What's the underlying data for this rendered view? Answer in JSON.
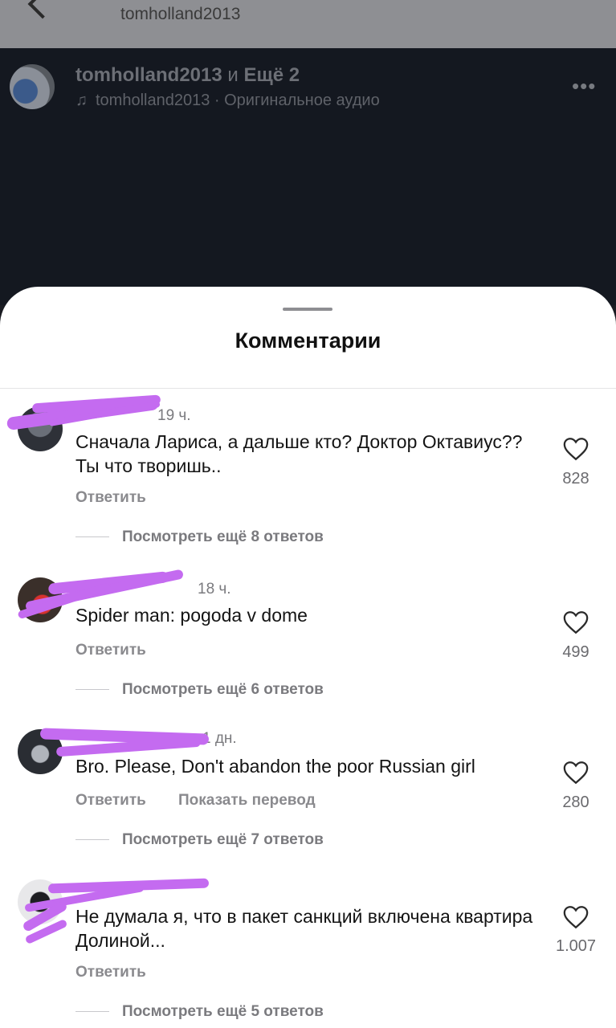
{
  "header": {
    "username": "tomholland2013"
  },
  "post": {
    "author": "tomholland2013",
    "conj": "и",
    "others": "Ещё 2",
    "audio_text": "tomholland2013 · Оригинальное аудио"
  },
  "sheet": {
    "title": "Комментарии"
  },
  "comments": [
    {
      "meta_suffix": "19 ч.",
      "text": "Сначала Лариса, а дальше кто? Доктор Октавиус?? Ты что творишь..",
      "reply": "Ответить",
      "translate": "",
      "more": "Посмотреть ещё 8 ответов",
      "likes": "828"
    },
    {
      "meta_suffix": "18 ч.",
      "text": "Spider man: pogoda v dome",
      "reply": "Ответить",
      "translate": "",
      "more": "Посмотреть ещё 6 ответов",
      "likes": "499"
    },
    {
      "meta_suffix": "1 дн.",
      "text": "Bro. Please, Don't abandon the poor Russian girl",
      "reply": "Ответить",
      "translate": "Показать перевод",
      "more": "Посмотреть ещё 7 ответов",
      "likes": "280"
    },
    {
      "meta_suffix": "",
      "text": "Не думала я, что в пакет санкций включена квартира Долиной...",
      "reply": "Ответить",
      "translate": "",
      "more": "Посмотреть ещё 5 ответов",
      "likes": "1.007"
    }
  ],
  "colors": {
    "scribble": "#c46bf0",
    "sheet": "#ffffff",
    "overlay": "#141820"
  },
  "icons": [
    "back-icon",
    "music-note-icon",
    "more-icon",
    "heart-icon"
  ]
}
